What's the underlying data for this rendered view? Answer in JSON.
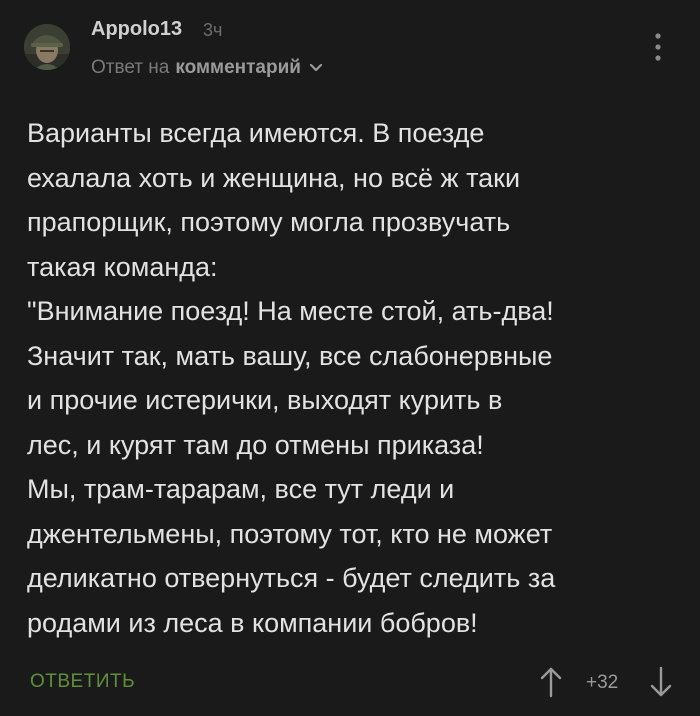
{
  "comment": {
    "author": "Appolo13",
    "time": "3ч",
    "reply_prefix": "Ответ на",
    "reply_target": "комментарий",
    "lines": [
      "Варианты всегда имеются. В поезде",
      "ехалала хоть и женщина, но всё ж таки",
      "прапорщик, поэтому могла прозвучать",
      "такая команда:",
      "\"Внимание поезд! На месте стой, ать-два!",
      "Значит так, мать вашу, все слабонервные",
      "и прочие истерички, выходят курить в",
      "лес, и курят там до отмены приказа!",
      "Мы, трам-тарарам, все тут леди и",
      "джентельмены, поэтому тот, кто не может",
      "деликатно отвернуться - будет следить за",
      "родами из леса в компании бобров!"
    ],
    "reply_label": "ОТВЕТИТЬ",
    "score": "+32"
  },
  "icons": {
    "avatar": "avatar",
    "menu": "kebab-menu-icon",
    "chevron": "chevron-down-icon",
    "upvote": "arrow-up-icon",
    "downvote": "arrow-down-icon"
  },
  "colors": {
    "background": "#1a1a1a",
    "text": "#e2e2e2",
    "muted": "#7a7a7a",
    "accent_green": "#5f8f3b"
  }
}
